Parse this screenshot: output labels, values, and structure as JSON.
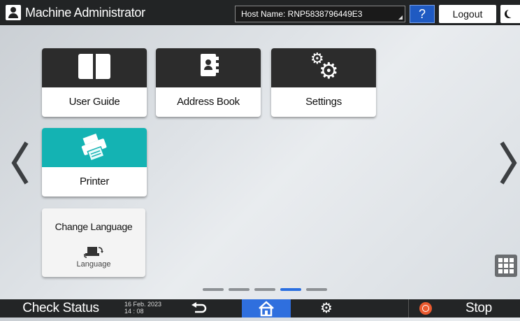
{
  "header": {
    "user_label": "Machine Administrator",
    "host_name": "Host Name: RNP5838796449E3",
    "help_label": "?",
    "logout_label": "Logout"
  },
  "tiles": [
    {
      "label": "User Guide",
      "icon": "book-icon"
    },
    {
      "label": "Address Book",
      "icon": "address-book-icon"
    },
    {
      "label": "Settings",
      "icon": "gears-icon"
    },
    {
      "label": "Printer",
      "icon": "printer-icon"
    }
  ],
  "language_tile": {
    "title": "Change Language",
    "sub_label": "Language",
    "icon": "language-switch-icon"
  },
  "pager": {
    "pages": 5,
    "active_page": 4
  },
  "footer": {
    "check_status_label": "Check Status",
    "date": "16 Feb. 2023",
    "time": "14 : 08",
    "stop_label": "Stop"
  },
  "colors": {
    "accent_blue": "#2f6fde",
    "printer_teal": "#14b3b3",
    "stop_orange": "#ea5a2f",
    "bar_dark": "#232526"
  }
}
